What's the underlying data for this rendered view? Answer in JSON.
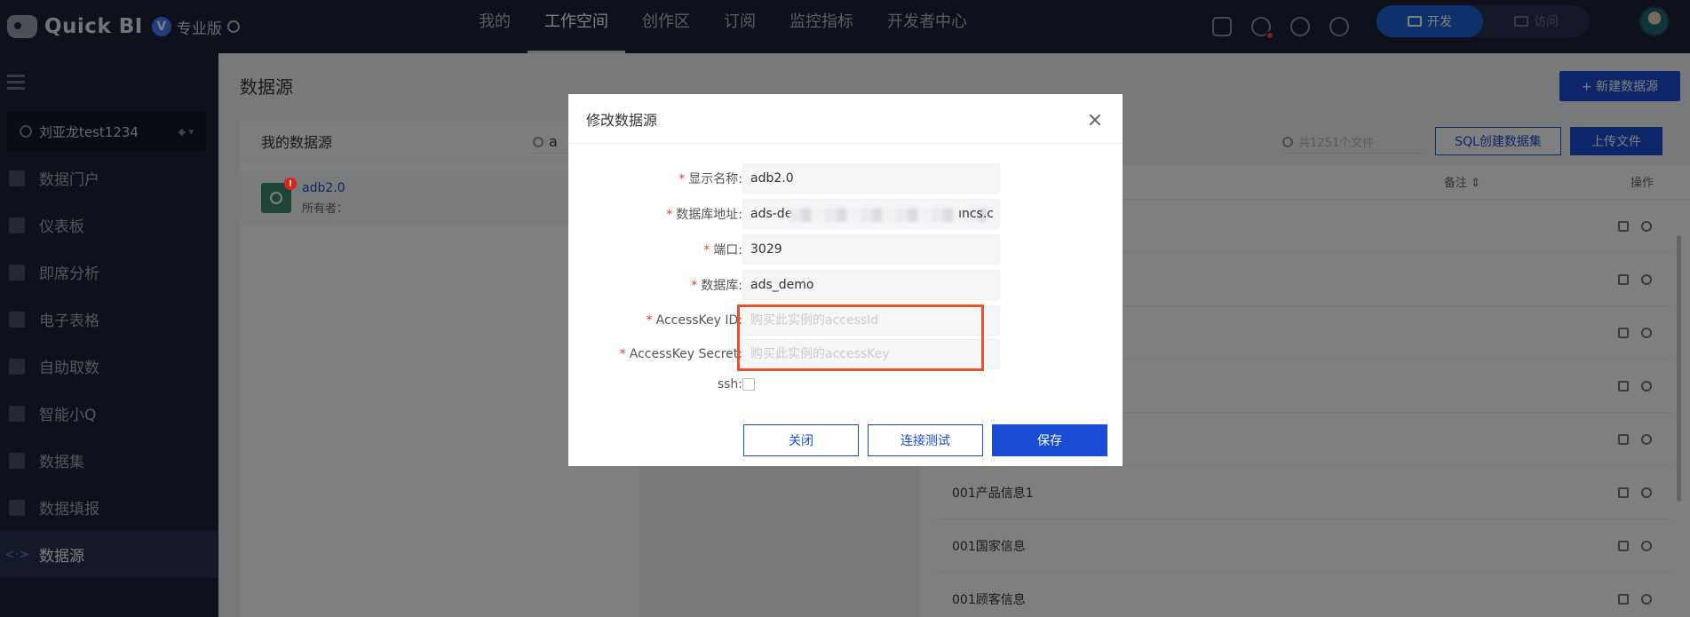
{
  "app": {
    "name": "Quick BI",
    "edition": "专业版"
  },
  "topnav": {
    "items": [
      {
        "label": "我的"
      },
      {
        "label": "工作空间",
        "active": true
      },
      {
        "label": "创作区"
      },
      {
        "label": "订阅"
      },
      {
        "label": "监控指标"
      },
      {
        "label": "开发者中心"
      }
    ],
    "mode": {
      "dev": "开发",
      "visit": "访问",
      "active": "dev"
    }
  },
  "sidebar": {
    "workspace": "刘亚龙test1234",
    "items": [
      {
        "label": "数据门户",
        "icon": "portal-icon"
      },
      {
        "label": "仪表板",
        "icon": "dashboard-icon"
      },
      {
        "label": "即席分析",
        "icon": "adhoc-icon"
      },
      {
        "label": "电子表格",
        "icon": "spreadsheet-icon"
      },
      {
        "label": "自助取数",
        "icon": "self-service-icon"
      },
      {
        "label": "智能小Q",
        "icon": "chat-icon"
      },
      {
        "label": "数据集",
        "icon": "dataset-icon"
      },
      {
        "label": "数据填报",
        "icon": "form-icon"
      },
      {
        "label": "数据源",
        "icon": "datasource-icon",
        "active": true
      }
    ]
  },
  "main": {
    "title": "数据源",
    "new_button": "+ 新建数据源",
    "left_panel": {
      "title": "我的数据源",
      "search_value": "a",
      "datasource": {
        "name": "adb2.0",
        "owner_label": "所有者："
      }
    },
    "right_panel": {
      "search_placeholder": "共1251个文件",
      "sql_button": "SQL创建数据集",
      "upload_button": "上传文件",
      "columns": {
        "note": "备注",
        "ops": "操作"
      },
      "rows": [
        {
          "name": ""
        },
        {
          "name": ""
        },
        {
          "name": ""
        },
        {
          "name": ""
        },
        {
          "name": ""
        },
        {
          "name": "001产品信息1"
        },
        {
          "name": "001国家信息"
        },
        {
          "name": "001顾客信息"
        }
      ]
    }
  },
  "modal": {
    "title": "修改数据源",
    "fields": {
      "display_name": {
        "label": "显示名称:",
        "value": "adb2.0"
      },
      "db_address": {
        "label": "数据库地址:",
        "value": "ads-de",
        "suffix": "ıncs.c"
      },
      "port": {
        "label": "端口:",
        "value": "3029"
      },
      "database": {
        "label": "数据库:",
        "value": "ads_demo"
      },
      "access_key_id": {
        "label": "AccessKey ID:",
        "placeholder": "购买此实例的accessId"
      },
      "access_key_secret": {
        "label": "AccessKey Secret:",
        "placeholder": "购买此实例的accessKey"
      },
      "ssh": {
        "label": "ssh:"
      }
    },
    "buttons": {
      "close": "关闭",
      "test": "连接测试",
      "save": "保存"
    }
  },
  "colors": {
    "accent": "#1a4bd3",
    "nav_bg": "#1c2138",
    "highlight": "#e8512a",
    "required": "#e23b2e"
  }
}
